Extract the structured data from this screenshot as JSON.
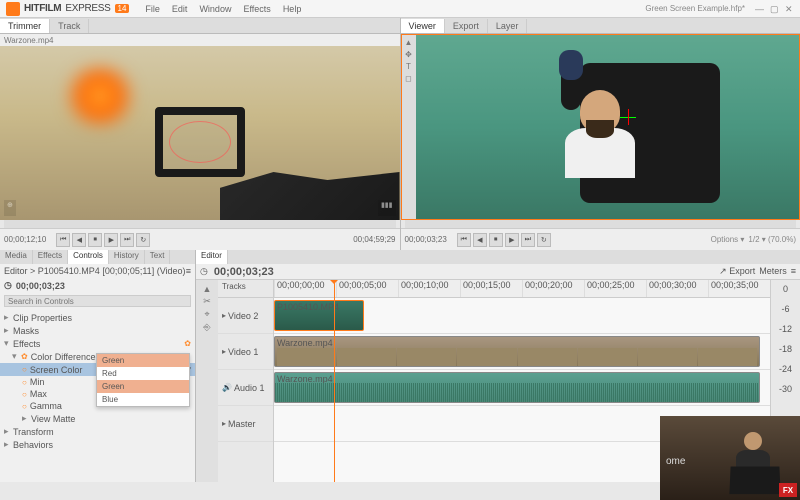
{
  "app": {
    "name": "HITFILM",
    "suffix": "EXPRESS",
    "badge": "14"
  },
  "menu": [
    "File",
    "Edit",
    "Window",
    "Effects",
    "Help"
  ],
  "project_name": "Green Screen Example.hfp*",
  "left_tabs": [
    "Trimmer",
    "Track"
  ],
  "left_clip": "Warzone.mp4",
  "left_tc_l": "00;00;12;10",
  "left_tc_r": "00;04;59;29",
  "right_tabs": [
    "Viewer",
    "Export",
    "Layer"
  ],
  "right_tc_l": "00;00;03;23",
  "right_zoom": "1/2 ▾ (70.0%)",
  "right_opts": "Options ▾",
  "transport": [
    "⏮",
    "◀",
    "⏹",
    "▶",
    "⏭",
    "↻"
  ],
  "ctrl_tabs": [
    "Media",
    "Effects",
    "Controls",
    "History",
    "Text"
  ],
  "editor_info": "Editor > P1005410.MP4 [00;00;05;11] (Video)",
  "ctrl_tc": "00;00;03;23",
  "search_ph": "Search in Controls",
  "tree": {
    "clip_props": "Clip Properties",
    "masks": "Masks",
    "effects": "Effects",
    "effect_name": "Color Difference Key",
    "screen_color": "Screen Color",
    "screen_val": "Green",
    "min": "Min",
    "max": "Max",
    "gamma": "Gamma",
    "view_matte": "View Matte",
    "transform": "Transform",
    "behaviors": "Behaviors"
  },
  "dropdown": [
    "Green",
    "Red",
    "Green",
    "Blue"
  ],
  "tl_tabs": [
    "Editor"
  ],
  "tl_tc": "00;00;03;23",
  "tl_export": "Export",
  "tl_meters": "Meters",
  "tracks_label": "Tracks",
  "tracks": {
    "v2": "Video 2",
    "v1": "Video 1",
    "a1": "Audio 1",
    "master": "Master"
  },
  "ruler": [
    "00;00;00;00",
    "00;00;05;00",
    "00;00;10;00",
    "00;00;15;00",
    "00;00;20;00",
    "00;00;25;00",
    "00;00;30;00",
    "00;00;35;00"
  ],
  "clips": {
    "v2": "P1005410.MP4",
    "v1": "Warzone.mp4",
    "a1": "Warzone.mp4"
  },
  "meter_marks": [
    "0",
    "-6",
    "-12",
    "-18",
    "-24",
    "-30"
  ],
  "pip": {
    "text": "ome",
    "logo": "FX"
  }
}
